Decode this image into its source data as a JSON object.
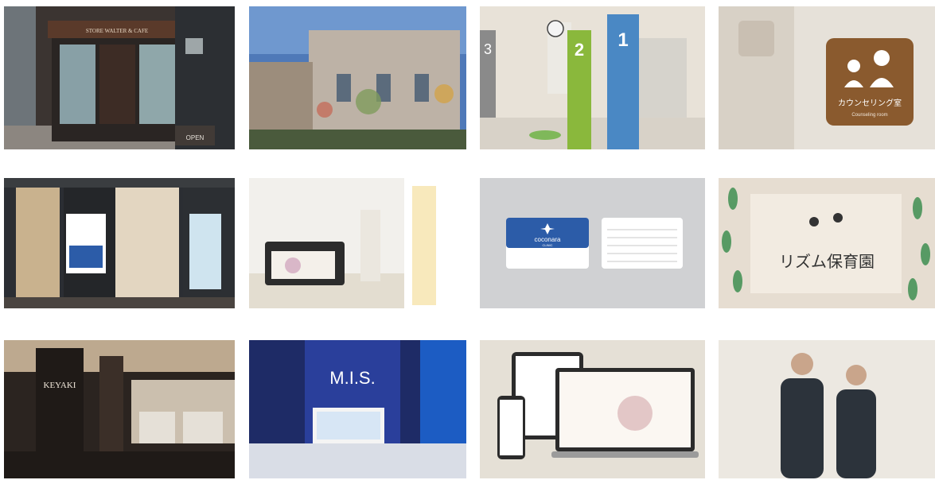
{
  "gallery": {
    "tiles": [
      {
        "id": "storefront-cafe",
        "sign": "STORE WALTER & CAFE",
        "door_sign": "OPEN"
      },
      {
        "id": "painted-building"
      },
      {
        "id": "clinic-booths",
        "booth_numbers": [
          "3",
          "2",
          "1"
        ]
      },
      {
        "id": "counseling-room-sign",
        "sign_jp": "カウンセリング室",
        "sign_en": "Counseling room"
      },
      {
        "id": "clinic-entrance"
      },
      {
        "id": "hallway-bench"
      },
      {
        "id": "business-cards",
        "brand": "coconara",
        "sub": "CLINIC"
      },
      {
        "id": "nursery-window",
        "sign": "リズム保育園"
      },
      {
        "id": "keyaki-cafe",
        "sign": "KEYAKI"
      },
      {
        "id": "mis-booth",
        "sign": "M.I.S."
      },
      {
        "id": "responsive-devices"
      },
      {
        "id": "staff-portrait"
      }
    ]
  }
}
